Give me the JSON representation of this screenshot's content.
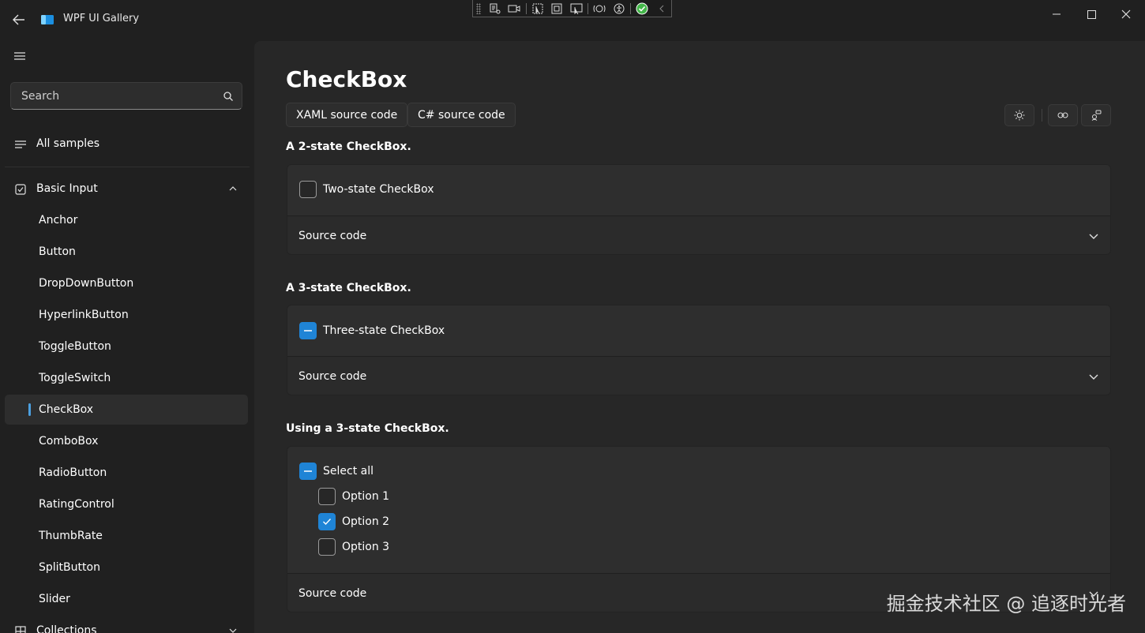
{
  "window": {
    "title": "WPF UI Gallery",
    "controls": [
      "minimize",
      "maximize",
      "close"
    ]
  },
  "sidebar": {
    "search_placeholder": "Search",
    "all_samples": "All samples",
    "group": {
      "label": "Basic Input",
      "expanded": true
    },
    "items": [
      "Anchor",
      "Button",
      "DropDownButton",
      "HyperlinkButton",
      "ToggleButton",
      "ToggleSwitch",
      "CheckBox",
      "ComboBox",
      "RadioButton",
      "RatingControl",
      "ThumbRate",
      "SplitButton",
      "Slider"
    ],
    "selected_item": "CheckBox",
    "next_group": {
      "label": "Collections"
    }
  },
  "main": {
    "title": "CheckBox",
    "buttons": {
      "xaml": "XAML source code",
      "csharp": "C# source code"
    },
    "sections": [
      {
        "title": "A 2-state CheckBox.",
        "checkbox": "Two-state CheckBox",
        "state": "unchecked",
        "source": "Source code"
      },
      {
        "title": "A 3-state CheckBox.",
        "checkbox": "Three-state CheckBox",
        "state": "indeterminate",
        "source": "Source code"
      },
      {
        "title": "Using a 3-state CheckBox.",
        "select_all": {
          "label": "Select all",
          "state": "indeterminate"
        },
        "options": [
          {
            "label": "Option 1",
            "state": "unchecked"
          },
          {
            "label": "Option 2",
            "state": "checked"
          },
          {
            "label": "Option 3",
            "state": "unchecked"
          }
        ],
        "source": "Source code"
      }
    ]
  },
  "watermark": "掘金技术社区 @ 追逐时光者",
  "colors": {
    "background": "#202020",
    "content": "#272727",
    "card": "#2b2b2b",
    "accent": "#1f84d6",
    "selection_indicator": "#4ca0e0"
  }
}
